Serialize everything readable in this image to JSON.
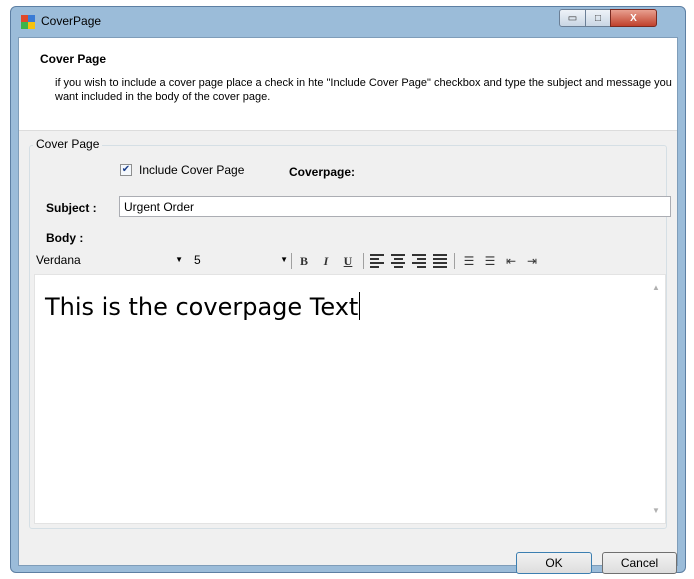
{
  "window": {
    "title": "CoverPage",
    "controls": {
      "minimize": "▭",
      "maximize": "□",
      "close": "X"
    }
  },
  "header": {
    "title": "Cover Page",
    "description": "if you wish to include a cover page place a check in hte \"Include Cover Page\" checkbox and type the subject and message you want included in the body of the cover page."
  },
  "group": {
    "legend": "Cover Page",
    "include_label": "Include Cover Page",
    "include_checked": true,
    "coverpage_label": "Coverpage:"
  },
  "subject": {
    "label": "Subject :",
    "value": "Urgent Order"
  },
  "body": {
    "label": "Body :",
    "text": "This is the coverpage Text"
  },
  "toolbar": {
    "font": "Verdana",
    "size": "5",
    "bold": "B",
    "italic": "I",
    "underline": "U",
    "icons": [
      "align-left-icon",
      "align-center-icon",
      "align-right-icon",
      "justify-icon",
      "numbered-list-icon",
      "bullet-list-icon",
      "outdent-icon",
      "indent-icon"
    ]
  },
  "buttons": {
    "ok": "OK",
    "cancel": "Cancel"
  },
  "colors": {
    "frame": "#9bbcd9",
    "close": "#c0412c",
    "client": "#f0f0f0"
  }
}
